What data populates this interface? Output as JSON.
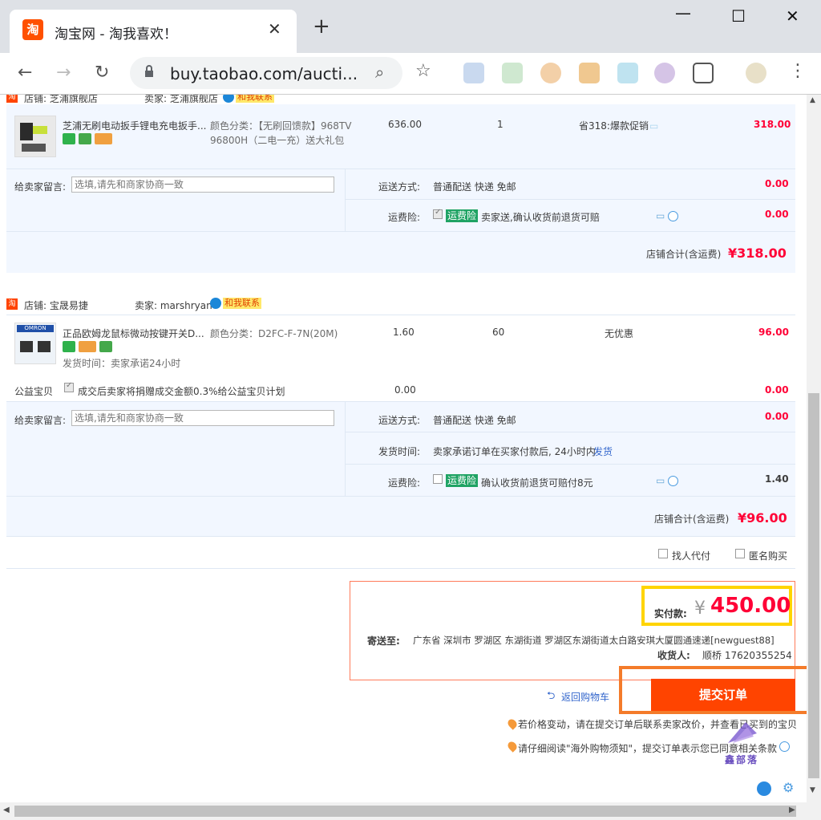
{
  "browser": {
    "tab_title": "淘宝网 - 淘我喜欢！",
    "tab_favicon": "淘",
    "url": "buy.taobao.com/aucti...",
    "new_tab": "+",
    "close_tab": "✕",
    "min": "—",
    "max": "☐",
    "close": "✕"
  },
  "shop1": {
    "shop_label": "店铺: 芝浦旗舰店",
    "seller_label": "卖家: 芝浦旗舰店",
    "contact": "和我联系",
    "item": {
      "title": "芝浦无刷电动扳手锂电充电扳手...",
      "spec_line1": "颜色分类：【无刷回馈款】968TV",
      "spec_line2": "96800H（二电一充）送大礼包",
      "price": "636.00",
      "qty": "1",
      "promo": "省318:爆款促销",
      "subtotal": "318.00"
    },
    "message_label": "给卖家留言:",
    "message_placeholder": "选填,请先和商家协商一致",
    "shipping_label": "运送方式:",
    "shipping_value": "普通配送 快递 免邮",
    "shipping_cost": "0.00",
    "insurance_label": "运费险:",
    "insurance_tag": "运费险",
    "insurance_text": "卖家送,确认收货前退货可赔",
    "insurance_cost": "0.00",
    "total_label": "店铺合计(含运费)",
    "total_value": "¥318.00"
  },
  "shop2": {
    "shop_label": "店铺: 宝晟易捷",
    "seller_label": "卖家: marshryan",
    "contact": "和我联系",
    "item": {
      "title": "正品欧姆龙鼠标微动按键开关D...",
      "spec": "颜色分类：D2FC-F-7N(20M)",
      "price": "1.60",
      "qty": "60",
      "promo": "无优惠",
      "subtotal": "96.00",
      "ship_time": "发货时间：卖家承诺24小时",
      "brand_text": "OMRON"
    },
    "charity_label": "公益宝贝",
    "charity_text": "成交后卖家将捐赠成交金额0.3%给公益宝贝计划",
    "charity_price": "0.00",
    "charity_cost": "0.00",
    "message_label": "给卖家留言:",
    "message_placeholder": "选填,请先和商家协商一致",
    "shipping_label": "运送方式:",
    "shipping_value": "普通配送 快递 免邮",
    "shipping_cost": "0.00",
    "delivery_label": "发货时间:",
    "delivery_value": "卖家承诺订单在买家付款后, 24小时内",
    "delivery_link": "发货",
    "insurance_label": "运费险:",
    "insurance_tag": "运费险",
    "insurance_text": "确认收货前退货可赔付8元",
    "insurance_cost": "1.40",
    "total_label": "店铺合计(含运费)",
    "total_value": "¥96.00"
  },
  "options": {
    "proxy_pay": "找人代付",
    "anonymous": "匿名购买"
  },
  "summary": {
    "pay_label": "实付款:",
    "currency": "¥",
    "amount": "450.00",
    "ship_to_label": "寄送至:",
    "address": "广东省 深圳市 罗湖区 东湖街道 罗湖区东湖街道太白路安琪大厦圆通速递[newguest88]",
    "receiver_label": "收货人:",
    "receiver": "顺桥 17620355254"
  },
  "actions": {
    "back_to_cart": "返回购物车",
    "submit": "提交订单"
  },
  "notes": {
    "price_change": "若价格变动，请在提交订单后联系卖家改价，并查看已买到的宝贝",
    "overseas": "请仔细阅读\"海外购物须知\"，提交订单表示您已同意相关条款"
  },
  "watermark": "鑫部落",
  "colors": {
    "accent": "#ff4400",
    "price_red": "#ff0036",
    "highlight_yellow": "#ffd400",
    "highlight_orange": "#f47b2a",
    "panel_blue": "#f2f7ff"
  }
}
